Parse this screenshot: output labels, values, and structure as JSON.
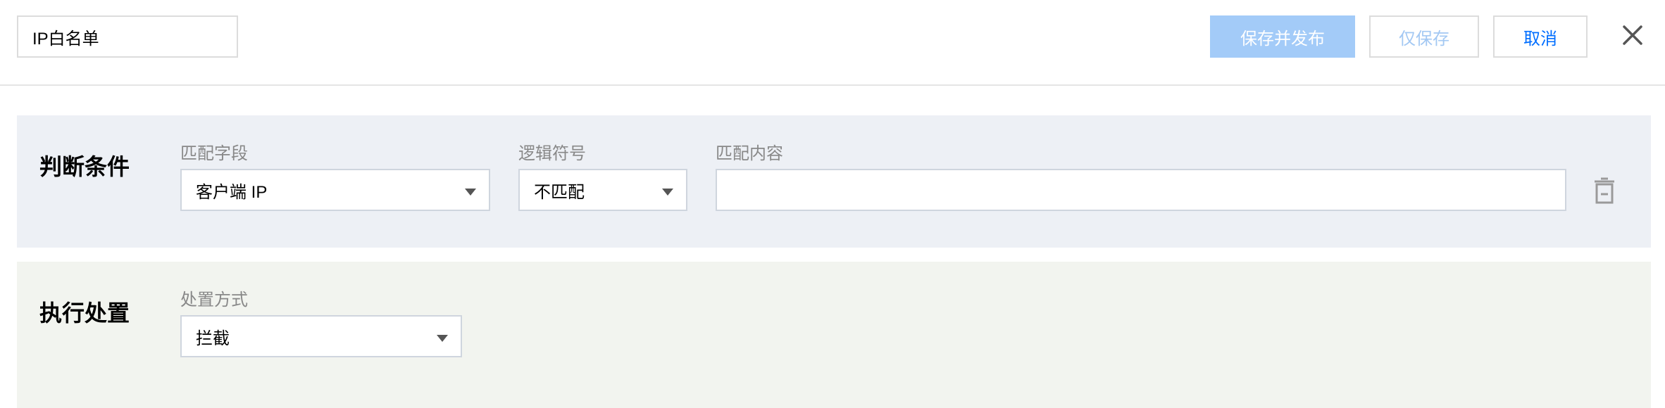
{
  "header": {
    "name_value": "IP白名单",
    "publish_label": "保存并发布",
    "save_label": "仅保存",
    "cancel_label": "取消"
  },
  "condition": {
    "title": "判断条件",
    "match_field_label": "匹配字段",
    "match_field_value": "客户端 IP",
    "operator_label": "逻辑符号",
    "operator_value": "不匹配",
    "content_label": "匹配内容",
    "content_value": ""
  },
  "action": {
    "title": "执行处置",
    "method_label": "处置方式",
    "method_value": "拦截"
  },
  "colors": {
    "primary": "#006eff",
    "primary_disabled": "#a3cbf8",
    "condition_bg": "#edf0f5",
    "action_bg": "#f2f4ef"
  },
  "icons": {
    "close": "close-icon",
    "delete": "trash-icon",
    "dropdown": "caret-down-icon"
  }
}
